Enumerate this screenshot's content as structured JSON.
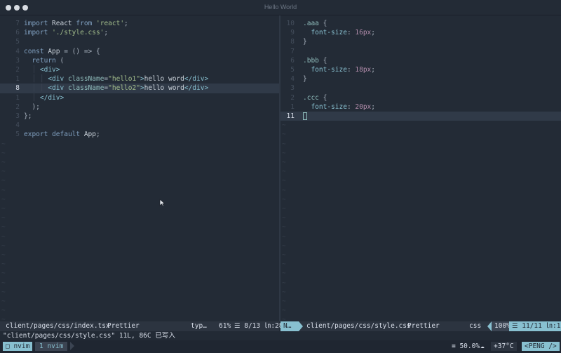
{
  "window": {
    "title": "Hello World"
  },
  "left_editor": {
    "lines": [
      {
        "n": "7",
        "parts": [
          [
            "kw",
            "import"
          ],
          [
            "plain",
            " React "
          ],
          [
            "kw",
            "from"
          ],
          [
            "plain",
            " "
          ],
          [
            "str",
            "'react'"
          ],
          [
            "punc",
            ";"
          ]
        ]
      },
      {
        "n": "6",
        "parts": [
          [
            "kw",
            "import"
          ],
          [
            "plain",
            " "
          ],
          [
            "str",
            "'./style.css'"
          ],
          [
            "punc",
            ";"
          ]
        ]
      },
      {
        "n": "5",
        "parts": []
      },
      {
        "n": "4",
        "parts": [
          [
            "kw",
            "const"
          ],
          [
            "plain",
            " App "
          ],
          [
            "punc",
            "= () => {"
          ]
        ]
      },
      {
        "n": "3",
        "parts": [
          [
            "guide",
            "  "
          ],
          [
            "kw",
            "return"
          ],
          [
            "punc",
            " ("
          ]
        ]
      },
      {
        "n": "2",
        "parts": [
          [
            "guide",
            "  │ "
          ],
          [
            "tag",
            "<div>"
          ]
        ]
      },
      {
        "n": "1",
        "parts": [
          [
            "guide",
            "  │ │ "
          ],
          [
            "tag",
            "<div "
          ],
          [
            "attr",
            "className"
          ],
          [
            "punc",
            "="
          ],
          [
            "str",
            "\"hello1\""
          ],
          [
            "tag",
            ">"
          ],
          [
            "plain",
            "hello word"
          ],
          [
            "tag",
            "</div>"
          ]
        ]
      },
      {
        "n": "8",
        "current": true,
        "parts": [
          [
            "guide",
            "  │ │ "
          ],
          [
            "tag",
            "<div "
          ],
          [
            "attr",
            "className"
          ],
          [
            "punc",
            "="
          ],
          [
            "str",
            "\"hello2\""
          ],
          [
            "tag",
            ">"
          ],
          [
            "plain",
            "hello word"
          ],
          [
            "tag",
            "</div>"
          ]
        ]
      },
      {
        "n": "1",
        "parts": [
          [
            "guide",
            "  │ "
          ],
          [
            "tag",
            "</div>"
          ]
        ]
      },
      {
        "n": "2",
        "parts": [
          [
            "guide",
            "  "
          ],
          [
            "punc",
            ");"
          ]
        ]
      },
      {
        "n": "3",
        "parts": [
          [
            "punc",
            "};"
          ]
        ]
      },
      {
        "n": "4",
        "parts": []
      },
      {
        "n": "5",
        "parts": [
          [
            "kw",
            "export"
          ],
          [
            "plain",
            " "
          ],
          [
            "kw",
            "default"
          ],
          [
            "plain",
            " App"
          ],
          [
            "punc",
            ";"
          ]
        ]
      }
    ]
  },
  "right_editor": {
    "lines": [
      {
        "n": "10",
        "parts": [
          [
            "sel",
            ".aaa"
          ],
          [
            "punc",
            " {"
          ]
        ]
      },
      {
        "n": "9",
        "parts": [
          [
            "plain",
            "  "
          ],
          [
            "prop",
            "font-size"
          ],
          [
            "punc",
            ": "
          ],
          [
            "num",
            "16px"
          ],
          [
            "punc",
            ";"
          ]
        ]
      },
      {
        "n": "8",
        "parts": [
          [
            "punc",
            "}"
          ]
        ]
      },
      {
        "n": "7",
        "parts": []
      },
      {
        "n": "6",
        "parts": [
          [
            "sel",
            ".bbb"
          ],
          [
            "punc",
            " {"
          ]
        ]
      },
      {
        "n": "5",
        "parts": [
          [
            "plain",
            "  "
          ],
          [
            "prop",
            "font-size"
          ],
          [
            "punc",
            ": "
          ],
          [
            "num",
            "18px"
          ],
          [
            "punc",
            ";"
          ]
        ]
      },
      {
        "n": "4",
        "parts": [
          [
            "punc",
            "}"
          ]
        ]
      },
      {
        "n": "3",
        "parts": []
      },
      {
        "n": "2",
        "parts": [
          [
            "sel",
            ".ccc"
          ],
          [
            "punc",
            " {"
          ]
        ]
      },
      {
        "n": "1",
        "parts": [
          [
            "plain",
            "  "
          ],
          [
            "prop",
            "font-size"
          ],
          [
            "punc",
            ": "
          ],
          [
            "num",
            "20px"
          ],
          [
            "punc",
            ";"
          ]
        ]
      },
      {
        "n": "11",
        "current": true,
        "cursor": true,
        "parts": []
      }
    ]
  },
  "status_left": {
    "file": "client/pages/css/index.tsx",
    "formatter": "Prettier",
    "filetype": "typ…",
    "percent": "61%",
    "position": "☰ 8/13 ㏑:28"
  },
  "status_right": {
    "mode": "N…",
    "file": "client/pages/css/style.css",
    "formatter": "Prettier",
    "filetype": "css",
    "percent": "100%",
    "position": "☰ 11/11 ㏑:1"
  },
  "message": "\"client/pages/css/style.css\" 11L, 86C 已写入",
  "tmux": {
    "session": "□ nvim",
    "window": "1 nvim",
    "cpu": "≡ 50.0%",
    "temp": "+37°C",
    "host": "<PENG />"
  }
}
